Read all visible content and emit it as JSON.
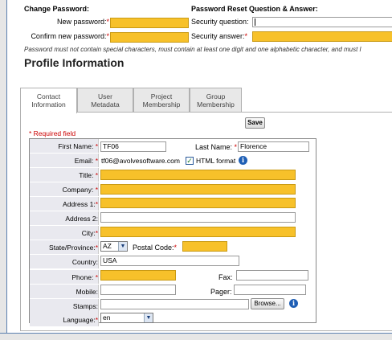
{
  "password_section": {
    "heading": "Change Password:",
    "new_password_label": "New password:",
    "confirm_password_label": "Confirm new password:",
    "required_marker": "*"
  },
  "reset_section": {
    "heading": "Password Reset Question & Answer:",
    "question_label": "Security question:",
    "answer_label": "Security answer:"
  },
  "note": "Password must not contain special characters, must contain at least one digit and one alphabetic character, and must l",
  "page_title": "Profile Information",
  "tabs": [
    {
      "line1": "Contact",
      "line2": "Information",
      "active": true
    },
    {
      "line1": "User",
      "line2": "Metadata",
      "active": false
    },
    {
      "line1": "Project",
      "line2": "Membership",
      "active": false
    },
    {
      "line1": "Group",
      "line2": "Membership",
      "active": false
    }
  ],
  "save_label": "Save",
  "required_note": "* Required field",
  "form": {
    "first_name": {
      "label": "First Name:",
      "value": "TF06"
    },
    "last_name": {
      "label": "Last Name:",
      "value": "Florence"
    },
    "email": {
      "label": "Email:",
      "value": "tf06@avolvesoftware.com"
    },
    "html_format_label": "HTML format",
    "title": {
      "label": "Title:"
    },
    "company": {
      "label": "Company:"
    },
    "address1": {
      "label": "Address 1:"
    },
    "address2": {
      "label": "Address 2:"
    },
    "city": {
      "label": "City:"
    },
    "state": {
      "label": "State/Province:",
      "value": "AZ"
    },
    "postal": {
      "label": "Postal Code:"
    },
    "country": {
      "label": "Country:",
      "value": "USA"
    },
    "phone": {
      "label": "Phone:"
    },
    "fax": {
      "label": "Fax:"
    },
    "mobile": {
      "label": "Mobile:"
    },
    "pager": {
      "label": "Pager:"
    },
    "stamps": {
      "label": "Stamps:"
    },
    "browse_label": "Browse...",
    "language": {
      "label": "Language:",
      "value": "en"
    }
  },
  "colors": {
    "required_field": "#f7c12a",
    "required_marker": "#cc0000",
    "info_icon": "#1f5fb5"
  }
}
